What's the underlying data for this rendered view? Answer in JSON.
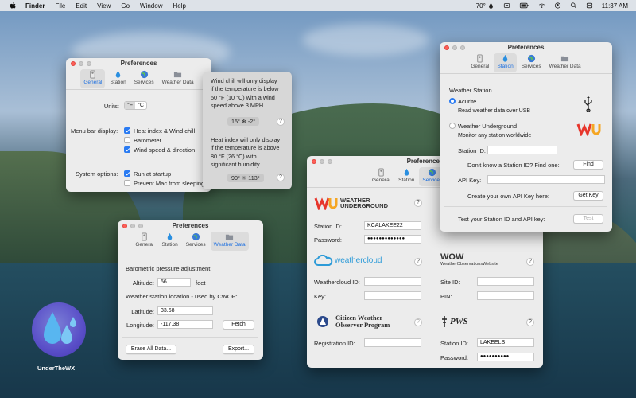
{
  "menubar": {
    "app": "Finder",
    "items": [
      "File",
      "Edit",
      "View",
      "Go",
      "Window",
      "Help"
    ],
    "temperature": "70°",
    "clock": "11:37 AM"
  },
  "desktop": {
    "app_icon_label": "UnderTheWX"
  },
  "tabs": {
    "general": "General",
    "station": "Station",
    "services": "Services",
    "weather_data": "Weather Data"
  },
  "win_general": {
    "title": "Preferences",
    "units_label": "Units:",
    "unit_f": "°F",
    "unit_c": "°C",
    "menu_bar_label": "Menu bar display:",
    "opt_heat": "Heat index & Wind chill",
    "opt_baro": "Barometer",
    "opt_wind": "Wind speed & direction",
    "system_label": "System options:",
    "opt_startup": "Run at startup",
    "opt_sleep": "Prevent Mac from sleeping"
  },
  "popover": {
    "wind_chill_text": [
      "Wind chill will only display",
      "if the temperature is below",
      "50 °F (10 °C) with a wind",
      "speed above 3 MPH."
    ],
    "wind_chill_chip": "15° ❄ -2°",
    "heat_text": [
      "Heat index will only display",
      "if the temperature is above",
      "80 °F (26 °C) with",
      "significant humidity."
    ],
    "heat_chip": "90° ☀ 113°",
    "help": "?"
  },
  "win_weather": {
    "title": "Preferences",
    "baro_label": "Barometric pressure adjustment:",
    "altitude_label": "Altitude:",
    "altitude_value": "56",
    "altitude_unit": "feet",
    "location_label": "Weather station location - used by CWOP:",
    "latitude_label": "Latitude:",
    "latitude_value": "33.68",
    "longitude_label": "Longitude:",
    "longitude_value": "-117.38",
    "fetch": "Fetch",
    "erase": "Erase All Data...",
    "export": "Export..."
  },
  "win_services": {
    "title": "Preferences",
    "wu_logo": [
      "WEATHER",
      "UNDERGROUND"
    ],
    "wu_station_label": "Station ID:",
    "wu_station_value": "KCALAKEE22",
    "wu_password_label": "Password:",
    "wu_password_value": "●●●●●●●●●●●●●",
    "wc_logo": "weathercloud",
    "wc_id_label": "Weathercloud ID:",
    "wc_key_label": "Key:",
    "wow_logo": "WOW",
    "wow_sub": "WeatherObservationsWebsite",
    "wow_site_label": "Site ID:",
    "wow_pin_label": "PIN:",
    "cwop_logo": [
      "Citizen Weather",
      "Observer Program"
    ],
    "cwop_reg_label": "Registration ID:",
    "pws_logo": "PWS",
    "pws_station_label": "Station ID:",
    "pws_station_value": "LAKEELS",
    "pws_password_label": "Password:",
    "pws_password_value": "●●●●●●●●●●"
  },
  "win_station": {
    "title": "Preferences",
    "section": "Weather Station",
    "acurite": "Acurite",
    "acurite_sub": "Read weather data over USB",
    "wu": "Weather Underground",
    "wu_sub": "Monitor any station worldwide",
    "station_id_label": "Station ID:",
    "find_text": "Don't know a Station ID?  Find one:",
    "find_btn": "Find",
    "api_label": "API Key:",
    "api_text": "Create your own API Key here:",
    "get_key": "Get Key",
    "test_text": "Test your Station ID and API key:",
    "test_btn": "Test",
    "wu_badge": "WU"
  },
  "colors": {
    "accent": "#2a7bf2",
    "close": "#fe5f57"
  }
}
